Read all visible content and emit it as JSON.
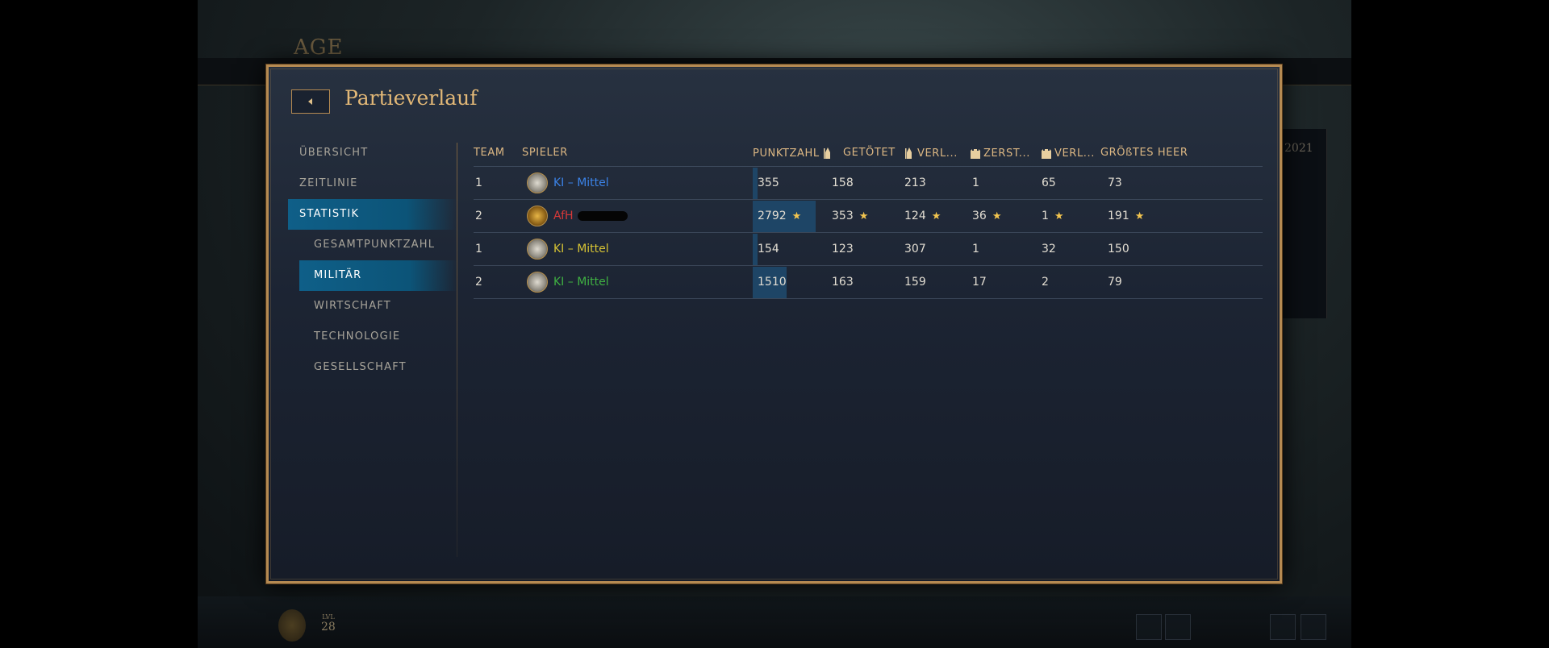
{
  "background": {
    "game_title": "AGE",
    "level_label": "LVL",
    "level_value": "28",
    "right_panel_text": "2021"
  },
  "dialog": {
    "title": "Partieverlauf",
    "back_icon": "chevron-left-icon"
  },
  "sidebar": {
    "items": [
      {
        "label": "ÜBERSICHT"
      },
      {
        "label": "ZEITLINIE"
      },
      {
        "label": "STATISTIK"
      },
      {
        "label": "GESAMTPUNKTZAHL"
      },
      {
        "label": "MILITÄR"
      },
      {
        "label": "WIRTSCHAFT"
      },
      {
        "label": "TECHNOLOGIE"
      },
      {
        "label": "GESELLSCHAFT"
      }
    ]
  },
  "table": {
    "headers": {
      "team": "TEAM",
      "player": "SPIELER",
      "score": "PUNKTZAHL",
      "killed": "GETÖTET",
      "lost": "VERL...",
      "destroyed": "ZERST...",
      "buildings_lost": "VERL...",
      "largest_army": "GRÖßTES HEER"
    },
    "header_icons": {
      "killed": "unit-icon",
      "lost": "unit-icon",
      "destroyed": "building-icon",
      "buildings_lost": "building-icon"
    },
    "rows": [
      {
        "team": "1",
        "player": "KI – Mittel",
        "player_color": "#3b82e6",
        "score": "355",
        "killed": "158",
        "lost": "213",
        "destroyed": "1",
        "buildings_lost": "65",
        "largest_army": "73",
        "score_fraction": 0.04
      },
      {
        "team": "2",
        "player": "AfH",
        "player_color": "#d63838",
        "score": "2792",
        "killed": "353",
        "lost": "124",
        "destroyed": "36",
        "buildings_lost": "1",
        "largest_army": "191",
        "score_fraction": 1.0
      },
      {
        "team": "1",
        "player": "KI – Mittel",
        "player_color": "#d6c334",
        "score": "154",
        "killed": "123",
        "lost": "307",
        "destroyed": "1",
        "buildings_lost": "32",
        "largest_army": "150",
        "score_fraction": 0.02
      },
      {
        "team": "2",
        "player": "KI – Mittel",
        "player_color": "#3fb042",
        "score": "1510",
        "killed": "163",
        "lost": "159",
        "destroyed": "17",
        "buildings_lost": "2",
        "largest_army": "79",
        "score_fraction": 0.54
      }
    ]
  },
  "colors": {
    "accent_gold": "#dcb783",
    "active_blue": "#0f5f88",
    "star": "#f3c54f"
  }
}
